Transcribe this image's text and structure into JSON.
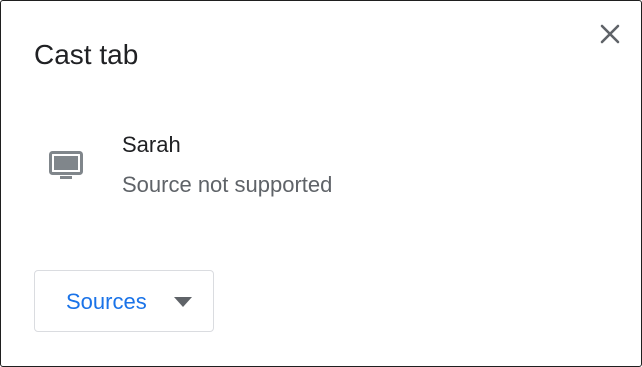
{
  "dialog": {
    "title": "Cast tab"
  },
  "sinks": [
    {
      "name": "Sarah",
      "status": "Source not supported",
      "icon": "monitor-icon"
    }
  ],
  "sources_button": {
    "label": "Sources",
    "icon": "caret-down-icon"
  },
  "close_button": {
    "icon": "close-icon"
  },
  "colors": {
    "title_text": "#202124",
    "secondary_text": "#5f6368",
    "link_blue": "#1a73e8",
    "icon_gray": "#80868b",
    "border_gray": "#dadce0"
  }
}
